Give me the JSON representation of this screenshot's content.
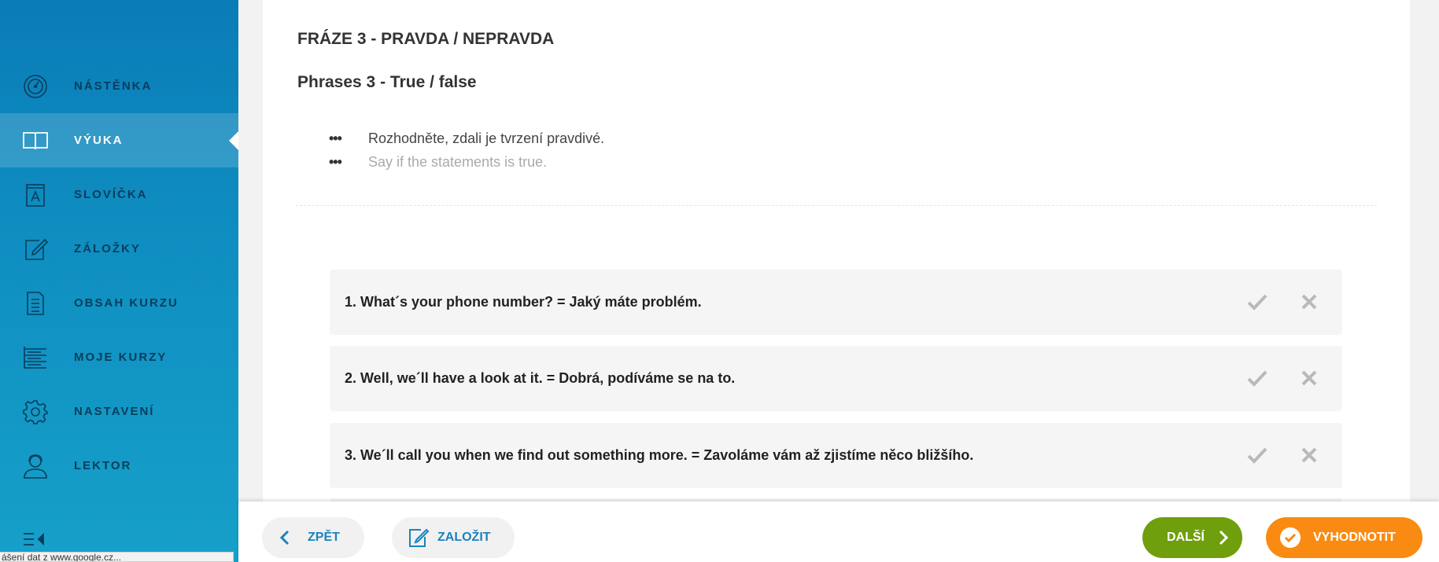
{
  "sidebar": {
    "items": [
      {
        "label": "NÁSTĚNKA",
        "icon": "dashboard-gauge-icon"
      },
      {
        "label": "VÝUKA",
        "icon": "open-book-icon",
        "active": true
      },
      {
        "label": "SLOVÍČKA",
        "icon": "vocabulary-card-icon"
      },
      {
        "label": "ZÁLOŽKY",
        "icon": "edit-note-icon"
      },
      {
        "label": "OBSAH KURZU",
        "icon": "document-list-icon"
      },
      {
        "label": "MOJE KURZY",
        "icon": "list-icon"
      },
      {
        "label": "NASTAVENÍ",
        "icon": "gear-icon"
      },
      {
        "label": "LEKTOR",
        "icon": "headset-user-icon"
      }
    ],
    "collapse_icon": "collapse-menu-icon",
    "status_url": "ášení dat z www.google.cz..."
  },
  "lesson": {
    "title_cz": "FRÁZE 3 - PRAVDA / NEPRAVDA",
    "title_en": "Phrases 3 - True / false",
    "instruction_cz": "Rozhodněte, zdali je tvrzení pravdivé.",
    "instruction_en": "Say if the statements is true.",
    "bullet": "•••"
  },
  "questions": [
    {
      "text": "1. What´s your phone number? = Jaký máte problém."
    },
    {
      "text": "2. Well, we´ll have a look at it. = Dobrá, podíváme se na to."
    },
    {
      "text": "3. We´ll call you when we find out something more. = Zavoláme vám až zjistíme něco bližšího."
    }
  ],
  "bottom_bar": {
    "back_label": "ZPĚT",
    "bookmark_label": "ZALOŽIT",
    "next_label": "DALŠÍ",
    "evaluate_label": "VYHODNOTIT"
  },
  "colors": {
    "sidebar": "#0a7cb8",
    "next": "#6f9f0c",
    "evaluate": "#f98b12",
    "link": "#1b82c0"
  }
}
